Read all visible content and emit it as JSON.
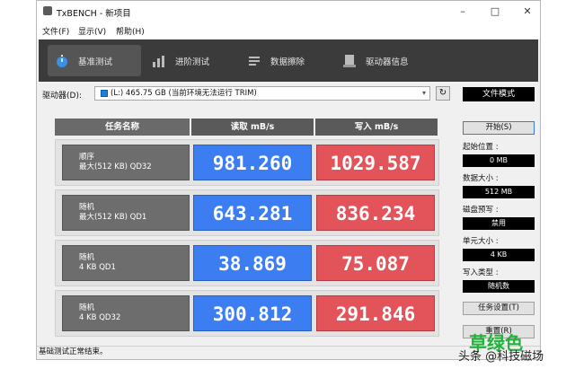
{
  "window": {
    "title": "TxBENCH - 新项目",
    "controls": [
      "–",
      "□",
      "✕"
    ]
  },
  "menu": [
    {
      "label": "文件(F)"
    },
    {
      "label": "显示(V)"
    },
    {
      "label": "帮助(H)"
    }
  ],
  "toolbar": [
    {
      "label": "基准测试",
      "icon": "stopwatch-icon",
      "active": true
    },
    {
      "label": "进阶测试",
      "icon": "bar-chart-icon",
      "active": false
    },
    {
      "label": "数据擦除",
      "icon": "eraser-icon",
      "active": false
    },
    {
      "label": "驱动器信息",
      "icon": "drive-info-icon",
      "active": false
    }
  ],
  "drive": {
    "label": "驱动器(D):",
    "selected": "(L:)  465.75 GB (当前环境无法运行 TRIM)"
  },
  "mode_label": "文件模式",
  "table": {
    "headers": [
      "任务名称",
      "读取 mB/s",
      "写入 mB/s"
    ],
    "rows": [
      {
        "line1": "顺序",
        "line2": "最大(512 KB) QD32",
        "read": "981.260",
        "write": "1029.587"
      },
      {
        "line1": "随机",
        "line2": "最大(512 KB) QD1",
        "read": "643.281",
        "write": "836.234"
      },
      {
        "line1": "随机",
        "line2": "4 KB QD1",
        "read": "38.869",
        "write": "75.087"
      },
      {
        "line1": "随机",
        "line2": "4 KB QD32",
        "read": "300.812",
        "write": "291.846"
      }
    ]
  },
  "right_panel": {
    "start_button": "开始(S)",
    "fields": [
      {
        "label": "起始位置 :",
        "value": "0 MB"
      },
      {
        "label": "数据大小 :",
        "value": "512 MB"
      },
      {
        "label": "磁盘预写 :",
        "value": "禁用"
      },
      {
        "label": "单元大小 :",
        "value": "4 KB"
      },
      {
        "label": "写入类型 :",
        "value": "随机数"
      }
    ],
    "task_settings_button": "任务设置(T)",
    "bottom_button": "重置(R)"
  },
  "status": "基础测试正常结束。",
  "watermark": {
    "line1": "草绿色",
    "line2": "头条 @科技磁场"
  },
  "colors": {
    "read": "#3c7ef2",
    "write": "#e2535a",
    "toolbar_bg": "#3b3b3b",
    "watermark": "#20b23a"
  }
}
